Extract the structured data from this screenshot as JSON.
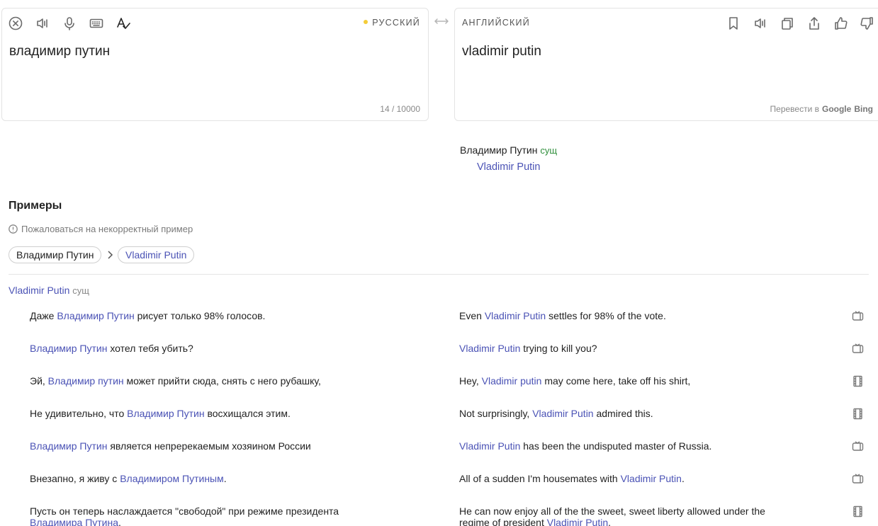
{
  "source": {
    "language": "РУССКИЙ",
    "text": "владимир путин",
    "char_count": "14 / 10000",
    "toolbar": [
      "clear-icon",
      "speaker-icon",
      "microphone-icon",
      "keyboard-icon",
      "spellcheck-icon"
    ]
  },
  "target": {
    "language": "АНГЛИЙСКИЙ",
    "text": "vladimir putin",
    "translate_via_label": "Перевести в",
    "engines": [
      "Google",
      "Bing"
    ],
    "toolbar": [
      "bookmark-icon",
      "speaker-icon",
      "copy-icon",
      "share-icon",
      "thumbs-up-icon",
      "thumbs-down-icon"
    ]
  },
  "dictionary": {
    "headword": "Владимир Путин",
    "pos": "сущ",
    "translation": "Vladimir Putin"
  },
  "examples": {
    "heading": "Примеры",
    "report_label": "Пожаловаться на некорректный пример",
    "chip_source": "Владимир Путин",
    "chip_target": "Vladimir Putin",
    "sense": "Vladimir Putin",
    "sense_pos": "сущ",
    "rows": [
      {
        "src": [
          {
            "t": "Даже "
          },
          {
            "t": "Владимир Путин",
            "hl": true
          },
          {
            "t": " рисует только 98% голосов."
          }
        ],
        "tgt": [
          {
            "t": "Even "
          },
          {
            "t": "Vladimir Putin",
            "hl": true
          },
          {
            "t": " settles for 98% of the vote."
          }
        ],
        "icon": "tv-icon"
      },
      {
        "src": [
          {
            "t": "Владимир Путин",
            "hl": true
          },
          {
            "t": " хотел тебя убить?"
          }
        ],
        "tgt": [
          {
            "t": "Vladimir Putin",
            "hl": true
          },
          {
            "t": " trying to kill you?"
          }
        ],
        "icon": "tv-icon"
      },
      {
        "src": [
          {
            "t": "Эй, "
          },
          {
            "t": "Владимир путин",
            "hl": true
          },
          {
            "t": " может прийти сюда, снять с него рубашку,"
          }
        ],
        "tgt": [
          {
            "t": "Hey, "
          },
          {
            "t": "Vladimir putin",
            "hl": true
          },
          {
            "t": " may come here, take off his shirt,"
          }
        ],
        "icon": "film-icon"
      },
      {
        "src": [
          {
            "t": "Не удивительно, что "
          },
          {
            "t": "Владимир Путин",
            "hl": true
          },
          {
            "t": " восхищался этим."
          }
        ],
        "tgt": [
          {
            "t": "Not surprisingly, "
          },
          {
            "t": "Vladimir Putin",
            "hl": true
          },
          {
            "t": " admired this."
          }
        ],
        "icon": "film-icon"
      },
      {
        "src": [
          {
            "t": "Владимир Путин",
            "hl": true
          },
          {
            "t": " является непререкаемым хозяином России"
          }
        ],
        "tgt": [
          {
            "t": "Vladimir Putin",
            "hl": true
          },
          {
            "t": " has been the undisputed master of Russia."
          }
        ],
        "icon": "tv-icon"
      },
      {
        "src": [
          {
            "t": "Внезапно, я живу с "
          },
          {
            "t": "Владимиром Путиным",
            "hl": true
          },
          {
            "t": "."
          }
        ],
        "tgt": [
          {
            "t": "All of a sudden I'm housemates with "
          },
          {
            "t": "Vladimir Putin",
            "hl": true
          },
          {
            "t": "."
          }
        ],
        "icon": "tv-icon"
      },
      {
        "src": [
          {
            "t": "Пусть он теперь наслаждается \"свободой\" при режиме президента "
          },
          {
            "t": "Владимира Путина",
            "hl": true
          },
          {
            "t": "."
          }
        ],
        "tgt": [
          {
            "t": "He can now enjoy all of the the sweet, sweet liberty allowed under the regime of president "
          },
          {
            "t": "Vladimir Putin",
            "hl": true
          },
          {
            "t": "."
          }
        ],
        "icon": "film-icon"
      }
    ]
  }
}
